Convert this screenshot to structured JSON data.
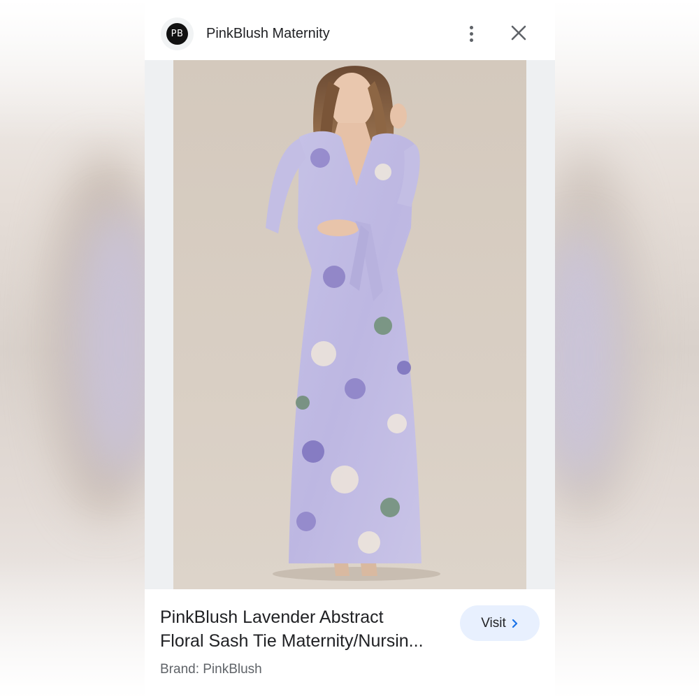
{
  "header": {
    "avatar_text": "PB",
    "site_name": "PinkBlush Maternity",
    "more_icon": "more-vert-icon",
    "close_icon": "close-icon"
  },
  "image": {
    "description_icon": "product-photo"
  },
  "product": {
    "title_line1": "PinkBlush Lavender Abstract",
    "title_line2": "Floral Sash Tie Maternity/Nursin...",
    "brand": "Brand: PinkBlush"
  },
  "visit_button": {
    "label": "Visit",
    "icon": "chevron-right-icon",
    "background": "#e8f0fe",
    "icon_color": "#1a73e8"
  },
  "colors": {
    "panel_bg": "#ffffff",
    "image_bg": "#eef0f2",
    "text_primary": "#202124",
    "text_secondary": "#5f6368"
  }
}
